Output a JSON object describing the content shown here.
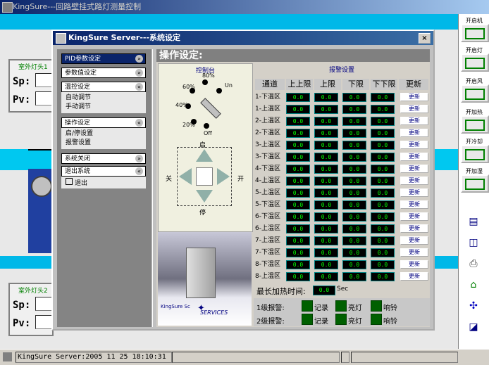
{
  "app": {
    "title": "KingSure---回路壁挂式路灯测量控制"
  },
  "background_panels": [
    {
      "label": "室外灯头1",
      "sp_label": "Sp:",
      "pv_label": "Pv:"
    },
    {
      "label": "室外灯头2",
      "sp_label": "Sp:",
      "pv_label": "Pv:"
    }
  ],
  "right_toolbar": {
    "buttons": [
      "开启机",
      "开启灯",
      "开启风",
      "开加热",
      "开冷却",
      "开加湿"
    ],
    "icons": [
      "report-icon",
      "chart-icon",
      "printer-icon",
      "home-icon",
      "network-icon",
      "exit-icon"
    ]
  },
  "statusbar": {
    "text": "KingSure Server:2005 11 25 18:10:31"
  },
  "dialog": {
    "title": "KingSure Server---系统设定",
    "close": "×",
    "sections": [
      {
        "label": "PID参数设定",
        "active": true,
        "chev": "»",
        "items": []
      },
      {
        "label": "参数值设定",
        "active": false,
        "chev": "»",
        "items": []
      },
      {
        "label": "温控设定",
        "active": false,
        "chev": "«",
        "items": [
          "自动调节",
          "手动调节"
        ]
      },
      {
        "label": "操作设定",
        "active": false,
        "chev": "«",
        "items": [
          "启/停设置",
          "报警设置"
        ]
      },
      {
        "label": "系统关闭",
        "active": false,
        "chev": "»",
        "items": []
      },
      {
        "label": "退出系统",
        "active": false,
        "chev": "«",
        "items": [
          "退出"
        ]
      }
    ],
    "op_title": "操作设定:",
    "control": {
      "title": "控制台",
      "dial_labels": [
        "60%",
        "80%",
        "Un",
        "40%",
        "20%",
        "Off"
      ],
      "left": "关",
      "right": "开",
      "up": "启",
      "down": "停"
    },
    "photo_caption": "SERVICES",
    "photo_brand": "KingSure Sc",
    "alarm": {
      "title": "报警设置",
      "headers": [
        "通道",
        "上上限",
        "上限",
        "下限",
        "下下限",
        "更新"
      ],
      "rows": [
        {
          "label": "1-下温区",
          "vals": [
            "0.0",
            "0.0",
            "0.0",
            "0.0"
          ],
          "btn": "更新"
        },
        {
          "label": "1-上温区",
          "vals": [
            "0.0",
            "0.0",
            "0.0",
            "0.0"
          ],
          "btn": "更新"
        },
        {
          "label": "2-上温区",
          "vals": [
            "0.0",
            "0.0",
            "0.0",
            "0.0"
          ],
          "btn": "更新"
        },
        {
          "label": "2-下温区",
          "vals": [
            "0.0",
            "0.0",
            "0.0",
            "0.0"
          ],
          "btn": "更新"
        },
        {
          "label": "3-上温区",
          "vals": [
            "0.0",
            "0.0",
            "0.0",
            "0.0"
          ],
          "btn": "更新"
        },
        {
          "label": "3-下温区",
          "vals": [
            "0.0",
            "0.0",
            "0.0",
            "0.0"
          ],
          "btn": "更新"
        },
        {
          "label": "4-下温区",
          "vals": [
            "0.0",
            "0.0",
            "0.0",
            "0.0"
          ],
          "btn": "更新"
        },
        {
          "label": "4-上温区",
          "vals": [
            "0.0",
            "0.0",
            "0.0",
            "0.0"
          ],
          "btn": "更新"
        },
        {
          "label": "5-上温区",
          "vals": [
            "0.0",
            "0.0",
            "0.0",
            "0.0"
          ],
          "btn": "更新"
        },
        {
          "label": "5-下温区",
          "vals": [
            "0.0",
            "0.0",
            "0.0",
            "0.0"
          ],
          "btn": "更新"
        },
        {
          "label": "6-下温区",
          "vals": [
            "0.0",
            "0.0",
            "0.0",
            "0.0"
          ],
          "btn": "更新"
        },
        {
          "label": "6-上温区",
          "vals": [
            "0.0",
            "0.0",
            "0.0",
            "0.0"
          ],
          "btn": "更新"
        },
        {
          "label": "7-上温区",
          "vals": [
            "0.0",
            "0.0",
            "0.0",
            "0.0"
          ],
          "btn": "更新"
        },
        {
          "label": "7-下温区",
          "vals": [
            "0.0",
            "0.0",
            "0.0",
            "0.0"
          ],
          "btn": "更新"
        },
        {
          "label": "8-下温区",
          "vals": [
            "0.0",
            "0.0",
            "0.0",
            "0.0"
          ],
          "btn": "更新"
        },
        {
          "label": "8-上温区",
          "vals": [
            "0.0",
            "0.0",
            "0.0",
            "0.0"
          ],
          "btn": "更新"
        }
      ]
    },
    "delay": {
      "label": "最长加热时间:",
      "value": "0.0",
      "unit": "Sec"
    },
    "levels": [
      {
        "label": "1级报警:",
        "items": [
          "记录",
          "亮灯",
          "响铃"
        ]
      },
      {
        "label": "2级报警:",
        "items": [
          "记录",
          "亮灯",
          "响铃"
        ]
      }
    ]
  }
}
